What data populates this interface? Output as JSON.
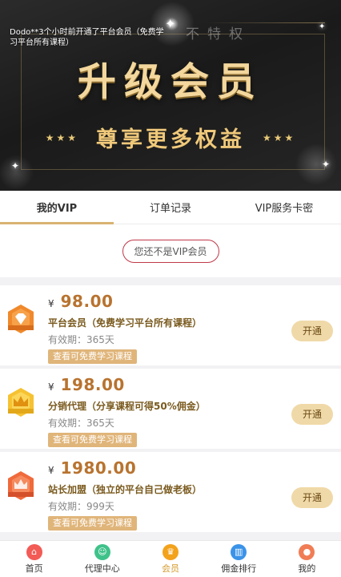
{
  "banner": {
    "notice": "Dodo**3个小时前开通了平台会员（免费学习平台所有课程）",
    "watermark": "不特权",
    "title": "升级会员",
    "subtitle": "尊享更多权益",
    "stars_left": "★★★",
    "stars_right": "★★★"
  },
  "tabs": [
    {
      "label": "我的VIP",
      "active": true
    },
    {
      "label": "订单记录",
      "active": false
    },
    {
      "label": "VIP服务卡密",
      "active": false
    }
  ],
  "status": {
    "text": "您还不是VIP会员"
  },
  "plans": [
    {
      "currency": "¥",
      "price": "98.00",
      "name": "平台会员（免费学习平台所有课程）",
      "validity": "有效期：365天",
      "view_label": "查看可免费学习课程",
      "open_label": "开通",
      "badge_icon": "diamond-badge-icon",
      "badge_color": "#f0892b"
    },
    {
      "currency": "¥",
      "price": "198.00",
      "name": "分销代理（分享课程可得50%佣金）",
      "validity": "有效期：365天",
      "view_label": "查看可免费学习课程",
      "open_label": "开通",
      "badge_icon": "crown-badge-icon",
      "badge_color": "#f6c232"
    },
    {
      "currency": "¥",
      "price": "1980.00",
      "name": "站长加盟（独立的平台自己做老板）",
      "validity": "有效期：999天",
      "view_label": "查看可免费学习课程",
      "open_label": "开通",
      "badge_icon": "crown-shield-badge-icon",
      "badge_color": "#f06a3c"
    }
  ],
  "nav": [
    {
      "label": "首页",
      "icon": "home-icon",
      "color": "#f25b56",
      "active": false
    },
    {
      "label": "代理中心",
      "icon": "agent-icon",
      "color": "#3fc28a",
      "active": false
    },
    {
      "label": "会员",
      "icon": "member-icon",
      "color": "#f3a21c",
      "active": true
    },
    {
      "label": "佣金排行",
      "icon": "ranking-icon",
      "color": "#3a93e8",
      "active": false
    },
    {
      "label": "我的",
      "icon": "profile-icon",
      "color": "#f07d55",
      "active": false
    }
  ]
}
